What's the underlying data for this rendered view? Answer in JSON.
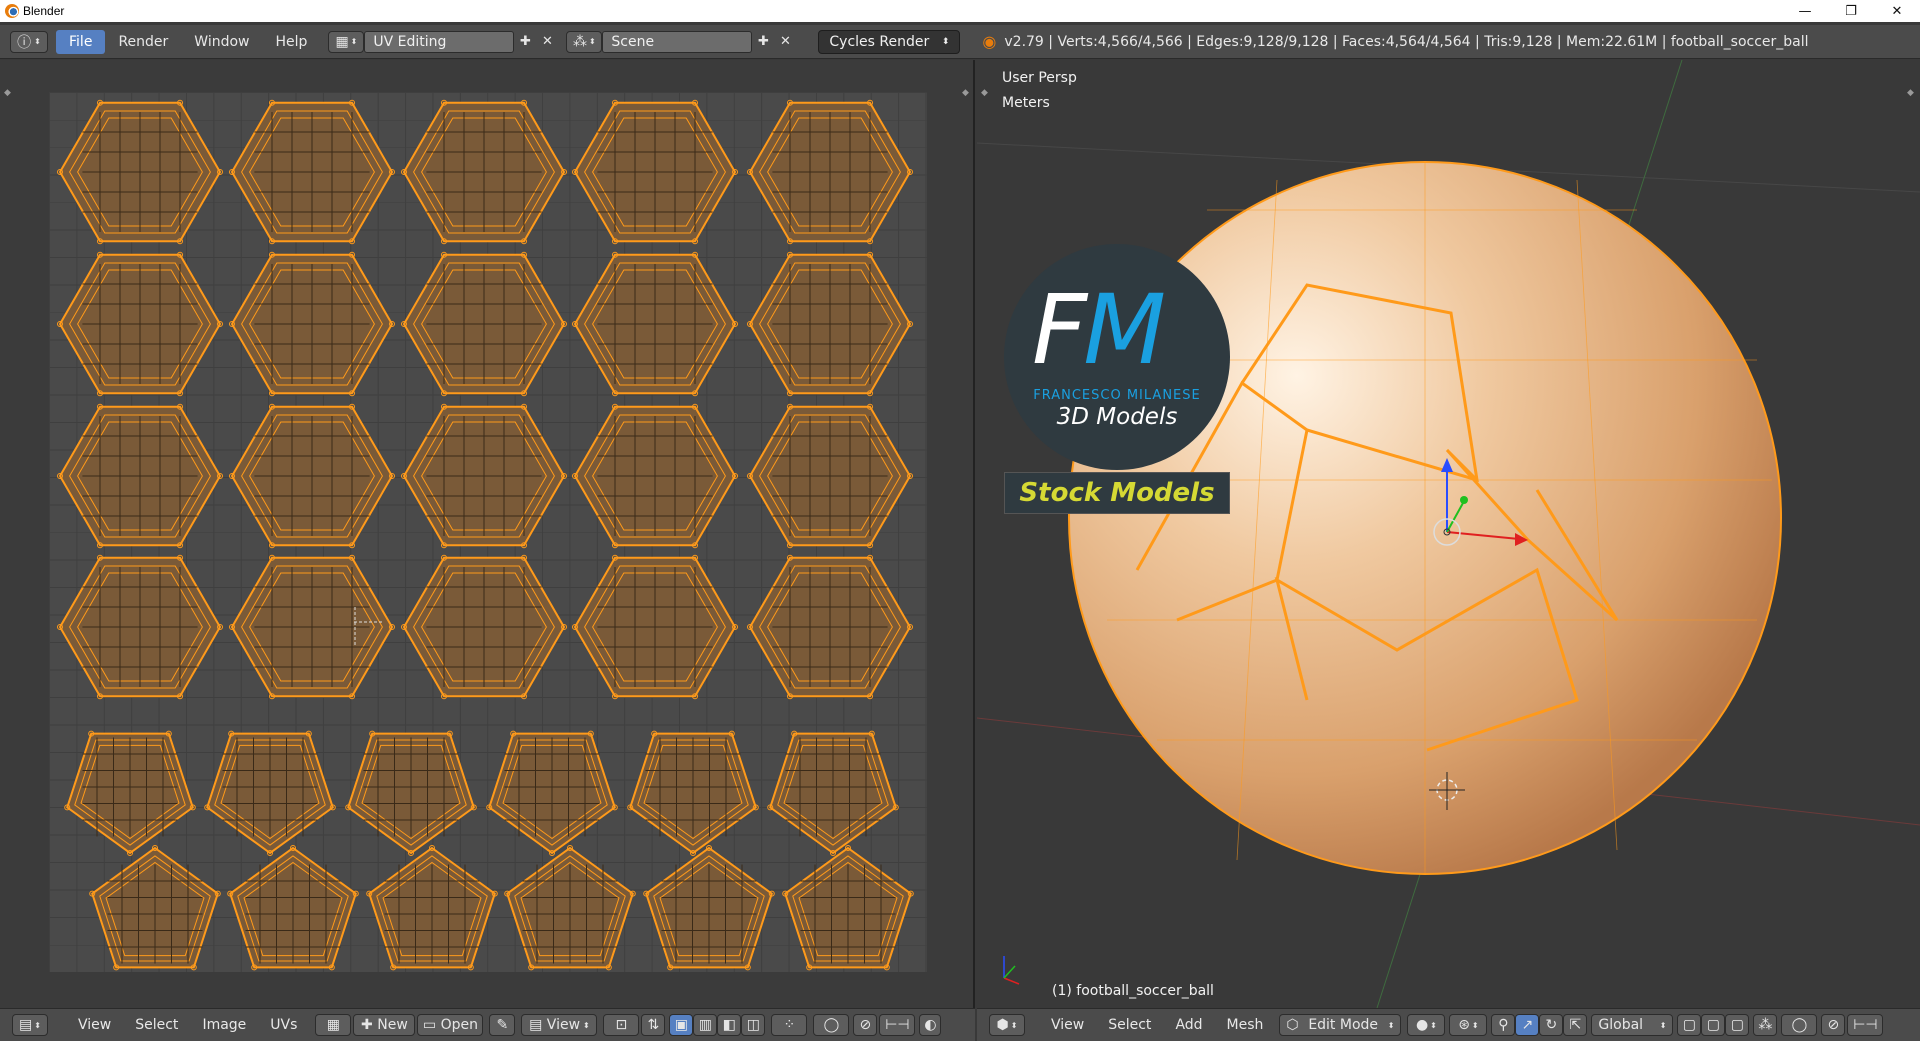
{
  "window": {
    "title": "Blender",
    "controls": [
      "—",
      "❐",
      "✕"
    ]
  },
  "info_header": {
    "menus": [
      "File",
      "Render",
      "Window",
      "Help"
    ],
    "active_menu": "File",
    "layout": "UV Editing",
    "scene": "Scene",
    "engine": "Cycles Render",
    "stats": "v2.79 | Verts:4,566/4,566 | Edges:9,128/9,128 | Faces:4,564/4,564 | Tris:9,128 | Mem:22.61M | football_soccer_ball"
  },
  "viewport": {
    "view_name": "User Persp",
    "units": "Meters",
    "object_label": "(1) football_soccer_ball"
  },
  "logo": {
    "letters_f": "F",
    "letters_m": "M",
    "name": "FRANCESCO MILANESE",
    "subtitle": "3D Models",
    "banner": "Stock Models"
  },
  "uv_footer": {
    "menus": [
      "View",
      "Select",
      "Image",
      "UVs"
    ],
    "new_label": "New",
    "open_label": "Open",
    "view_label": "View"
  },
  "view3d_footer": {
    "menus": [
      "View",
      "Select",
      "Add",
      "Mesh"
    ],
    "mode": "Edit Mode",
    "orientation": "Global"
  },
  "colors": {
    "accent": "#5680c2",
    "uv_face": "#7a5a38",
    "uv_edge": "#ff9a1a",
    "ball": "#e8b98a"
  }
}
